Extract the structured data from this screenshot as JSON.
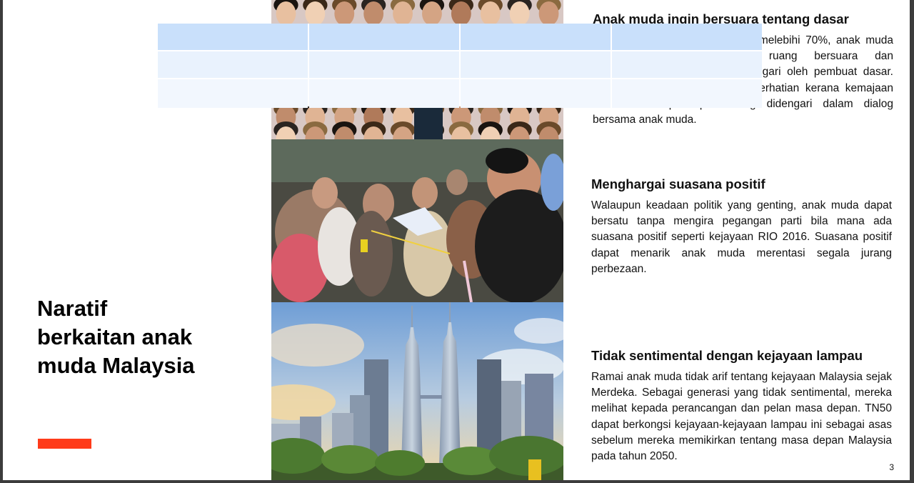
{
  "slide": {
    "title": "Naratif\nberkaitan anak\nmuda Malaysia",
    "page_number": "3",
    "accent_color": "#ff3b1a"
  },
  "sections": [
    {
      "heading": "Anak muda ingin bersuara tentang dasar",
      "body": "Dengan jumlah pengundi muda melebihi 70%, anak muda dalam negara memerlukan ruang bersuara dan menyampaikan pandangan didengari oleh pembuat dasar. Dasar-dasar kerajaan menjadi perhatian kerana kemajaan dan saluran pendapat sering didengari dalam dialog bersama anak muda."
    },
    {
      "heading": "Menghargai suasana positif",
      "body": "Walaupun keadaan politik yang genting, anak muda dapat bersatu tanpa mengira pegangan parti bila mana ada suasana positif seperti kejayaan RIO 2016. Suasana positif dapat menarik anak muda merentasi segala jurang perbezaan."
    },
    {
      "heading": "Tidak sentimental dengan kejayaan lampau",
      "body": "Ramai anak muda tidak arif tentang kejayaan Malaysia sejak Merdeka. Sebagai generasi yang tidak sentimental, mereka melihat kepada perancangan dan pelan masa depan. TN50 dapat berkongsi kejayaan-kejayaan lampau ini sebagai asas sebelum mereka memikirkan tentang masa depan Malaysia pada tahun 2050."
    }
  ],
  "overlay_table": {
    "rows": [
      [
        "",
        "",
        "",
        ""
      ],
      [
        "",
        "",
        "",
        ""
      ],
      [
        "",
        "",
        "",
        ""
      ]
    ]
  },
  "photos": {
    "faces": "faces-mosaic-image",
    "crowd": "crowd-image",
    "skyline": "petronas-towers-image"
  }
}
